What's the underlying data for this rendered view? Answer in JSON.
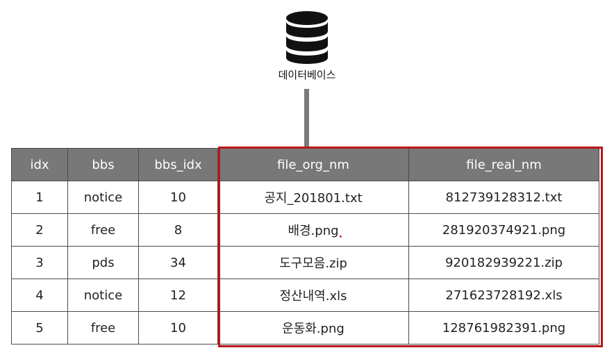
{
  "database": {
    "icon": "database-icon",
    "label": "데이터베이스"
  },
  "table": {
    "headers": {
      "idx": "idx",
      "bbs": "bbs",
      "bbs_idx": "bbs_idx",
      "file_org_nm": "file_org_nm",
      "file_real_nm": "file_real_nm"
    },
    "rows": [
      {
        "idx": "1",
        "bbs": "notice",
        "bbs_idx": "10",
        "file_org_nm": "공지_201801.txt",
        "file_real_nm": "812739128312.txt"
      },
      {
        "idx": "2",
        "bbs": "free",
        "bbs_idx": "8",
        "file_org_nm": "배경.png",
        "file_real_nm": "281920374921.png"
      },
      {
        "idx": "3",
        "bbs": "pds",
        "bbs_idx": "34",
        "file_org_nm": "도구모음.zip",
        "file_real_nm": "920182939221.zip"
      },
      {
        "idx": "4",
        "bbs": "notice",
        "bbs_idx": "12",
        "file_org_nm": "정산내역.xls",
        "file_real_nm": "271623728192.xls"
      },
      {
        "idx": "5",
        "bbs": "free",
        "bbs_idx": "10",
        "file_org_nm": "운동화.png",
        "file_real_nm": "128761982391.png"
      }
    ]
  },
  "colors": {
    "highlight": "#b8151b",
    "header_bg": "#787878",
    "connector": "#7a7a7a"
  }
}
